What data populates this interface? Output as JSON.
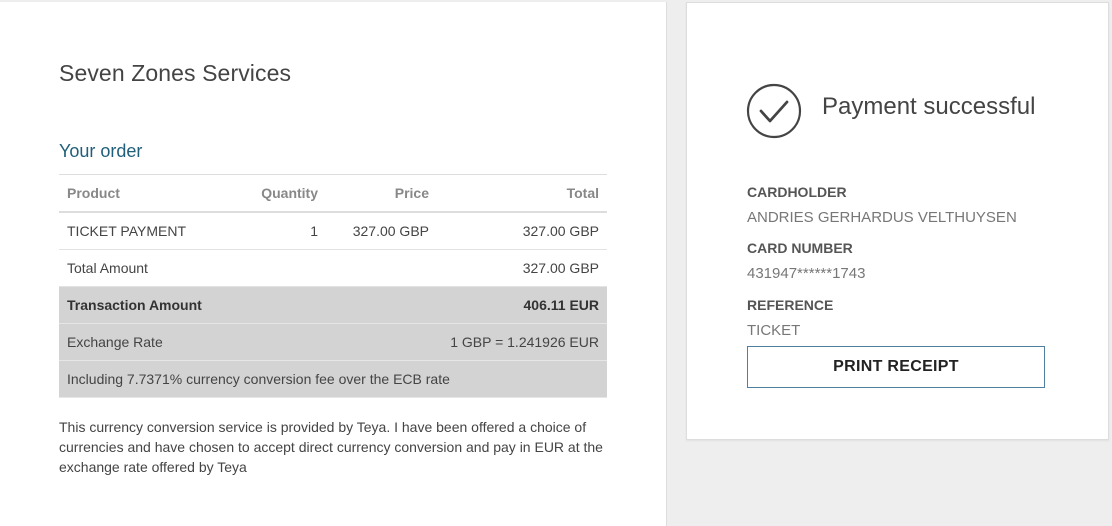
{
  "merchant": {
    "name": "Seven Zones Services"
  },
  "order": {
    "title": "Your order",
    "headers": {
      "product": "Product",
      "quantity": "Quantity",
      "price": "Price",
      "total": "Total"
    },
    "item": {
      "product": "TICKET PAYMENT",
      "quantity": "1",
      "price": "327.00 GBP",
      "total": "327.00 GBP"
    },
    "total_amount": {
      "label": "Total Amount",
      "value": "327.00 GBP"
    },
    "transaction_amount": {
      "label": "Transaction Amount",
      "value": "406.11 EUR"
    },
    "exchange_rate": {
      "label": "Exchange Rate",
      "value": "1 GBP = 1.241926 EUR"
    },
    "fee_note": "Including 7.7371% currency conversion fee over the ECB rate"
  },
  "disclaimer": "This currency conversion service is provided by Teya. I have been offered a choice of currencies and have chosen to accept direct currency conversion and pay in EUR at the exchange rate offered by Teya",
  "payment": {
    "status_icon": "check-circle-icon",
    "status_text": "Payment successful",
    "cardholder_label": "CARDHOLDER",
    "cardholder_value": "ANDRIES GERHARDUS VELTHUYSEN",
    "card_number_label": "CARD NUMBER",
    "card_number_value": "431947******1743",
    "reference_label": "REFERENCE",
    "reference_value": "TICKET",
    "print_button": "PRINT RECEIPT"
  },
  "colors": {
    "accent": "#1f5f7a",
    "button_border": "#4f7ea1",
    "shaded_row": "#d3d3d3"
  }
}
